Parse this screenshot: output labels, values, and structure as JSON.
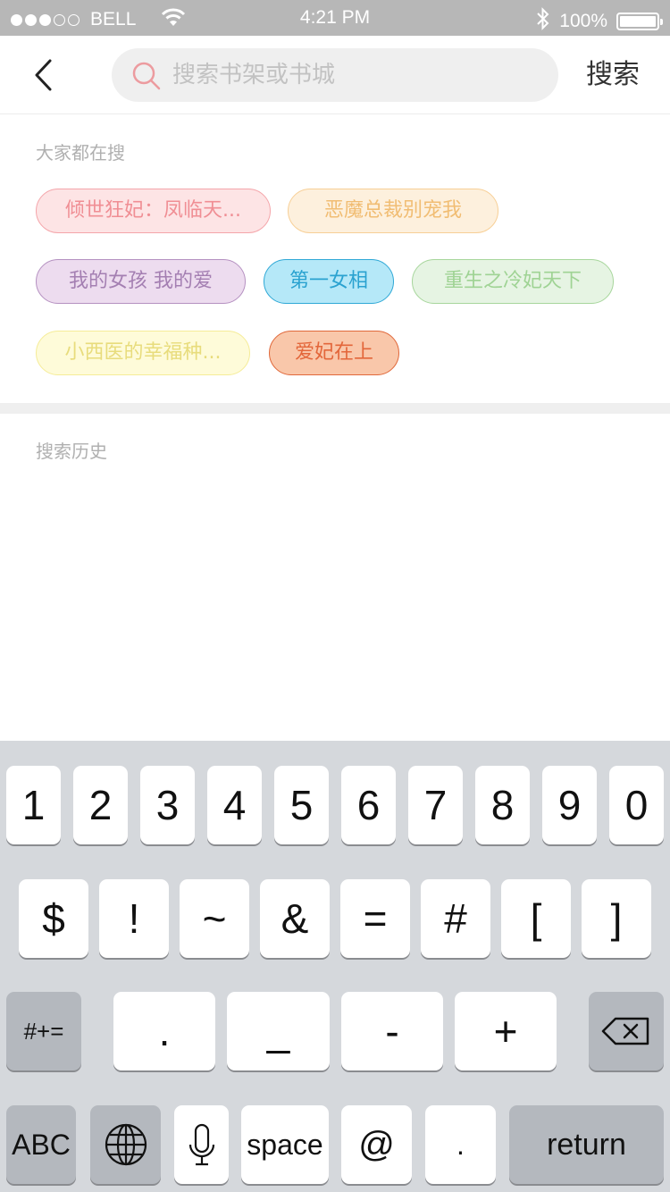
{
  "status_bar": {
    "carrier": "BELL",
    "time": "4:21 PM",
    "battery_percent": "100%",
    "battery_level": 1.0,
    "signal_bars_filled": 3,
    "signal_bars_total": 5,
    "icons": [
      "wifi-icon",
      "bluetooth-icon",
      "battery-icon"
    ]
  },
  "header": {
    "back_icon": "chevron-left-icon",
    "search_placeholder": "搜索书架或书城",
    "search_value": "",
    "search_icon": "search-icon",
    "search_button": "搜索"
  },
  "hot_searches": {
    "label": "大家都在搜",
    "tags": [
      {
        "text": "倾世狂妃：凤临天...",
        "color": "#f08e94"
      },
      {
        "text": "恶魔总裁别宠我",
        "color": "#f1bd73"
      },
      {
        "text": "我的女孩  我的爱",
        "color": "#a47fb2"
      },
      {
        "text": "第一女相",
        "color": "#2aa2d0"
      },
      {
        "text": "重生之冷妃天下",
        "color": "#9fd394"
      },
      {
        "text": "小西医的幸福种...",
        "color": "#e8dc7c"
      },
      {
        "text": "爱妃在上",
        "color": "#e3663a"
      }
    ]
  },
  "history": {
    "label": "搜索历史",
    "items": []
  },
  "keyboard": {
    "row1": [
      "1",
      "2",
      "3",
      "4",
      "5",
      "6",
      "7",
      "8",
      "9",
      "0"
    ],
    "row2": [
      "$",
      "!",
      "~",
      "&",
      "=",
      "#",
      "[",
      "]"
    ],
    "row3": {
      "shift": "#+=",
      "keys": [
        ".",
        "_",
        "-",
        "+"
      ],
      "delete_icon": "backspace-icon"
    },
    "row4": {
      "abc": "ABC",
      "globe_icon": "globe-icon",
      "mic_icon": "microphone-icon",
      "space": "space",
      "at": "@",
      "dot": ".",
      "return": "return"
    }
  }
}
